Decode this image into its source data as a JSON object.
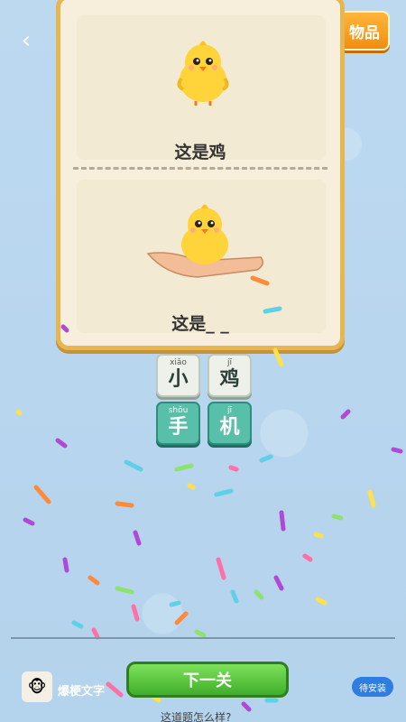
{
  "nav": {
    "back_icon": "chevron-left-icon",
    "back_glyph": "‹"
  },
  "items_button": {
    "label": "物品"
  },
  "puzzle": {
    "top_caption": "这是鸡",
    "bottom_caption": "这是_ _"
  },
  "answer_tiles": [
    {
      "pinyin": "xiǎo",
      "char": "小",
      "style": "light"
    },
    {
      "pinyin": "jī",
      "char": "鸡",
      "style": "light"
    },
    {
      "pinyin": "shǒu",
      "char": "手",
      "style": "teal"
    },
    {
      "pinyin": "jī",
      "char": "机",
      "style": "teal"
    }
  ],
  "footer": {
    "next_label": "下一关",
    "ad_name": "爆梗文字",
    "install_label": "待安装",
    "feedback_label": "这道题怎么样?"
  },
  "colors": {
    "background": "#b9d7ee",
    "card_border": "#e7b64f",
    "items_button": "#f08d10",
    "tile_teal": "#58bfa9",
    "next_button": "#3fae2a",
    "install_button": "#2f7de1"
  }
}
